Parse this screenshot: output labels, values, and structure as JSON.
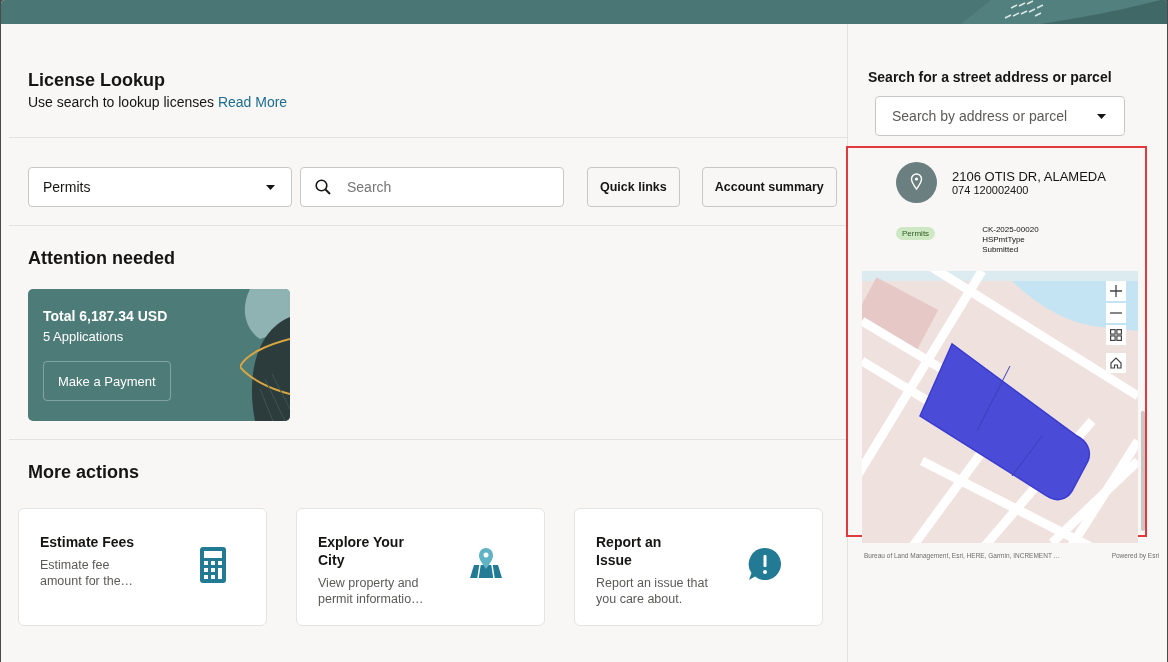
{
  "lookup": {
    "title": "License Lookup",
    "subtitle": "Use search to lookup licenses",
    "link": "Read More"
  },
  "filters": {
    "category": "Permits",
    "search_placeholder": "Search",
    "buttons": [
      "Quick links",
      "Account summary"
    ]
  },
  "attention": {
    "title": "Attention needed",
    "total": "Total 6,187.34 USD",
    "count": "5 Applications",
    "action": "Make a Payment"
  },
  "more_actions": {
    "title": "More actions",
    "cards": [
      {
        "kind": "calculator",
        "title": "Estimate Fees",
        "description": "Estimate fee amount for the…"
      },
      {
        "kind": "map",
        "title": "Explore Your City",
        "description": "View property and permit informatio…"
      },
      {
        "kind": "alert",
        "title": "Report an Issue",
        "description": "Report an issue that you care about."
      }
    ]
  },
  "parcel_search": {
    "title": "Search for a street address or parcel",
    "placeholder": "Search by address or parcel"
  },
  "result": {
    "address": "2106 OTIS DR, ALAMEDA",
    "parcel": "074 120002400",
    "tag": "Permits",
    "record": [
      "CK-2025-00020",
      "HSPmtType",
      "Submitted"
    ]
  },
  "map": {
    "attribution": "Bureau of Land Management, Esri, HERE, Garmin, INCREMENT …",
    "credit": "Powered by Esri"
  }
}
